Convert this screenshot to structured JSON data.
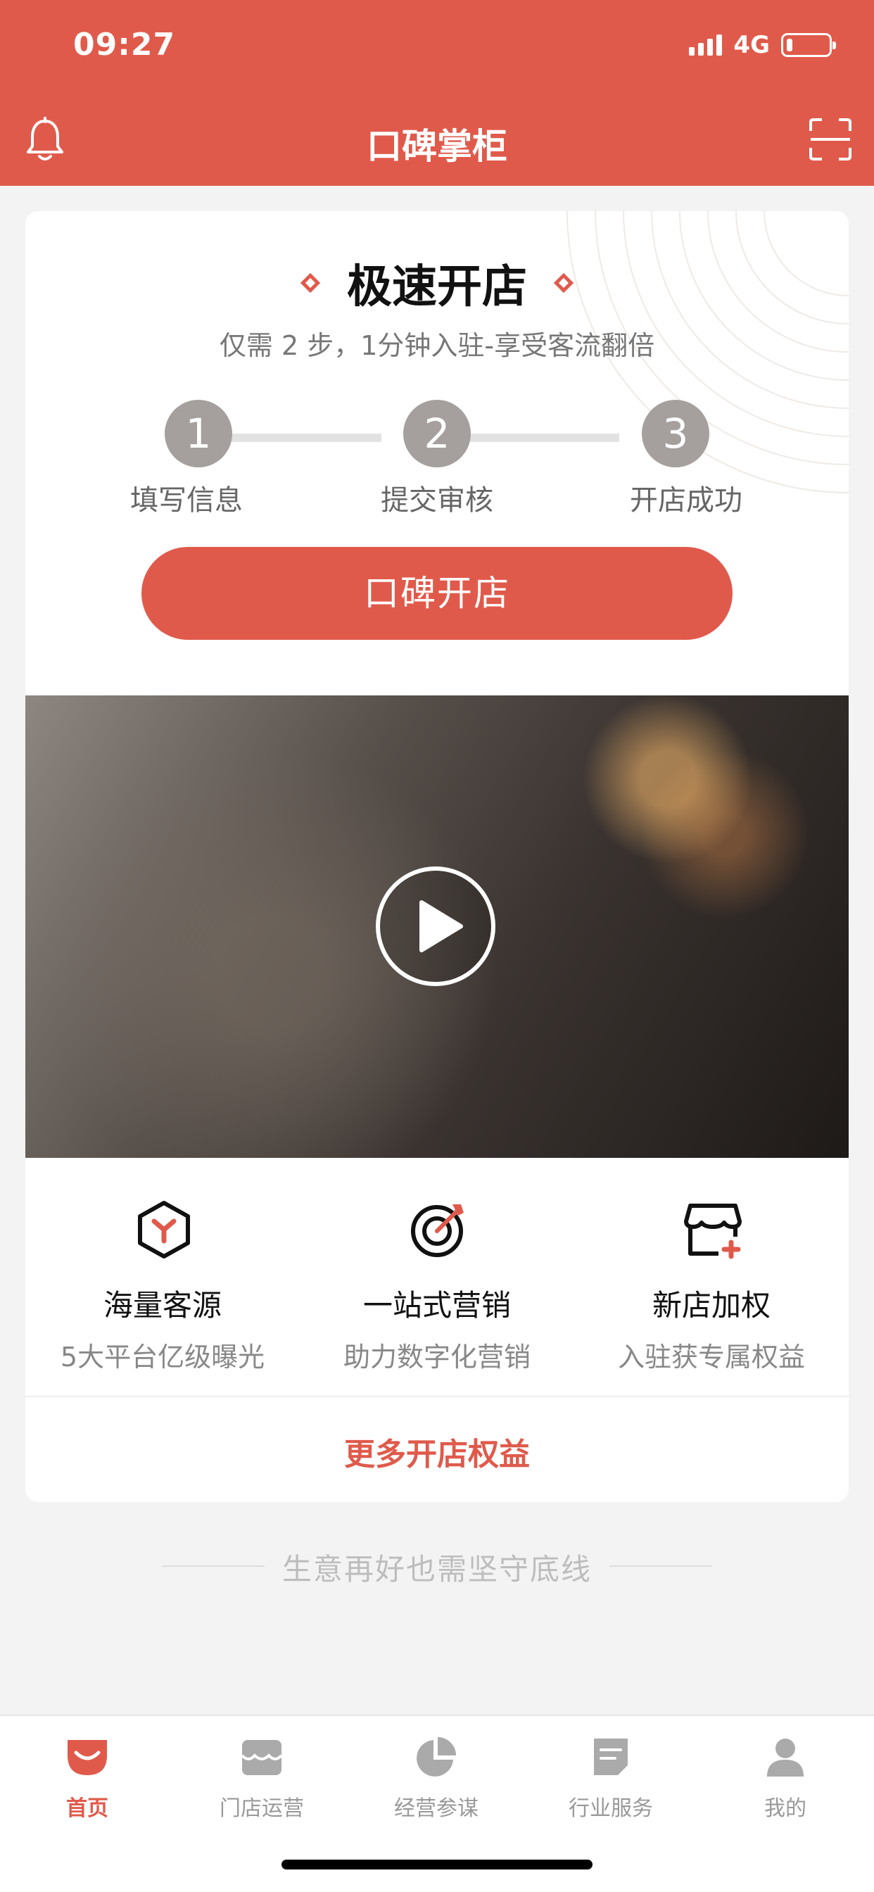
{
  "status_bar": {
    "time": "09:27",
    "network": "4G",
    "battery_level": 0.15
  },
  "header": {
    "title": "口碑掌柜",
    "left_icon": "bell-icon",
    "right_icon": "scan-icon"
  },
  "card": {
    "title": "极速开店",
    "subtitle": "仅需 2 步，1分钟入驻-享受客流翻倍",
    "steps": [
      {
        "number": "1",
        "label": "填写信息"
      },
      {
        "number": "2",
        "label": "提交审核"
      },
      {
        "number": "3",
        "label": "开店成功"
      }
    ],
    "cta_label": "口碑开店",
    "video_icon": "play-icon",
    "features": [
      {
        "icon": "hexagon-y-icon",
        "title": "海量客源",
        "desc": "5大平台亿级曝光"
      },
      {
        "icon": "target-icon",
        "title": "一站式营销",
        "desc": "助力数字化营销"
      },
      {
        "icon": "shop-plus-icon",
        "title": "新店加权",
        "desc": "入驻获专属权益"
      }
    ],
    "more_link": "更多开店权益"
  },
  "tagline": "生意再好也需坚守底线",
  "tabs": [
    {
      "label": "首页",
      "icon": "home-smile-icon",
      "active": true
    },
    {
      "label": "门店运营",
      "icon": "store-icon",
      "active": false
    },
    {
      "label": "经营参谋",
      "icon": "pie-chart-icon",
      "active": false
    },
    {
      "label": "行业服务",
      "icon": "document-icon",
      "active": false
    },
    {
      "label": "我的",
      "icon": "user-icon",
      "active": false
    }
  ],
  "colors": {
    "primary": "#e05a4b",
    "background": "#f3f3f3",
    "inactive": "#999999"
  }
}
